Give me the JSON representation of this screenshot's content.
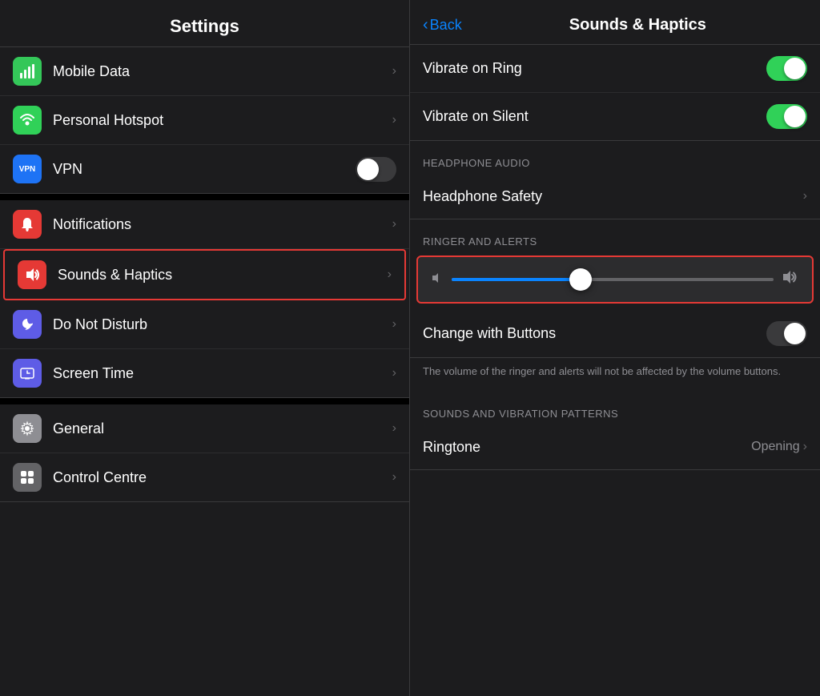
{
  "left": {
    "header": {
      "title": "Settings"
    },
    "items_top": [
      {
        "id": "mobile-data",
        "label": "Mobile Data",
        "icon_bg": "icon-green",
        "icon_unicode": "📶",
        "has_chevron": true,
        "has_toggle": false
      },
      {
        "id": "personal-hotspot",
        "label": "Personal Hotspot",
        "icon_bg": "icon-green2",
        "icon_unicode": "🔗",
        "has_chevron": true,
        "has_toggle": false
      },
      {
        "id": "vpn",
        "label": "VPN",
        "icon_bg": "icon-vpn",
        "icon_unicode": "VPN",
        "has_chevron": false,
        "has_toggle": true,
        "toggle_on": false
      }
    ],
    "items_middle": [
      {
        "id": "notifications",
        "label": "Notifications",
        "icon_bg": "icon-red",
        "icon_unicode": "🔔",
        "has_chevron": true,
        "highlighted": false
      },
      {
        "id": "sounds-haptics",
        "label": "Sounds & Haptics",
        "icon_bg": "icon-sounds",
        "icon_unicode": "🔊",
        "has_chevron": true,
        "highlighted": true
      },
      {
        "id": "do-not-disturb",
        "label": "Do Not Disturb",
        "icon_bg": "icon-purple",
        "icon_unicode": "🌙",
        "has_chevron": true
      },
      {
        "id": "screen-time",
        "label": "Screen Time",
        "icon_bg": "icon-orange",
        "icon_unicode": "⏳",
        "has_chevron": true
      }
    ],
    "items_bottom": [
      {
        "id": "general",
        "label": "General",
        "icon_bg": "icon-gray2",
        "icon_unicode": "⚙️",
        "has_chevron": true
      },
      {
        "id": "control-centre",
        "label": "Control Centre",
        "icon_bg": "icon-gray",
        "icon_unicode": "⊞",
        "has_chevron": true
      }
    ]
  },
  "right": {
    "header": {
      "back_label": "Back",
      "title": "Sounds & Haptics"
    },
    "vibrate_section": [
      {
        "id": "vibrate-ring",
        "label": "Vibrate on Ring",
        "toggle_on": true
      },
      {
        "id": "vibrate-silent",
        "label": "Vibrate on Silent",
        "toggle_on": true
      }
    ],
    "headphone_section_header": "HEADPHONE AUDIO",
    "headphone_items": [
      {
        "id": "headphone-safety",
        "label": "Headphone Safety",
        "has_chevron": true
      }
    ],
    "ringer_section_header": "RINGER AND ALERTS",
    "ringer_slider": {
      "value": 40,
      "min_icon": "🔇",
      "max_icon": "🔊"
    },
    "change_with_buttons": {
      "label": "Change with Buttons",
      "toggle_on": false
    },
    "change_note": "The volume of the ringer and alerts will not be affected by the volume buttons.",
    "patterns_section_header": "SOUNDS AND VIBRATION PATTERNS",
    "patterns_items": [
      {
        "id": "ringtone",
        "label": "Ringtone",
        "value": "Opening",
        "has_chevron": true
      }
    ]
  }
}
